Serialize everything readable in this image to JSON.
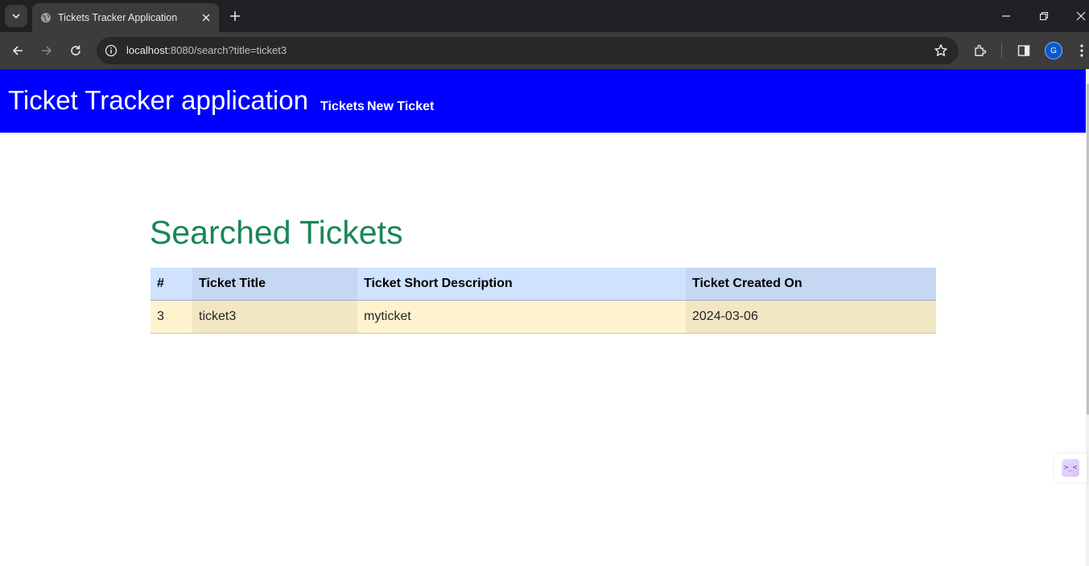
{
  "browser": {
    "tab_title": "Tickets Tracker Application",
    "url_host": "localhost",
    "url_rest": ":8080/search?title=ticket3",
    "profile_initial": "G",
    "icons": [
      "tab-search-icon",
      "globe-icon",
      "close-icon",
      "plus-icon",
      "minimize-icon",
      "restore-icon",
      "close-window-icon",
      "back-icon",
      "forward-icon",
      "reload-icon",
      "site-info-icon",
      "star-icon",
      "extensions-icon",
      "side-panel-icon",
      "more-icon"
    ]
  },
  "navbar": {
    "brand": "Ticket Tracker application",
    "links": [
      {
        "label": "Tickets"
      },
      {
        "label": "New Ticket"
      }
    ],
    "background": "#0000ff"
  },
  "main": {
    "heading": "Searched Tickets",
    "heading_color": "#198754",
    "table": {
      "headers": [
        "#",
        "Ticket Title",
        "Ticket Short Description",
        "Ticket Created On"
      ],
      "rows": [
        [
          "3",
          "ticket3",
          "myticket",
          "2024-03-06"
        ]
      ]
    }
  },
  "side_widget": {
    "glyph": ">_<"
  }
}
